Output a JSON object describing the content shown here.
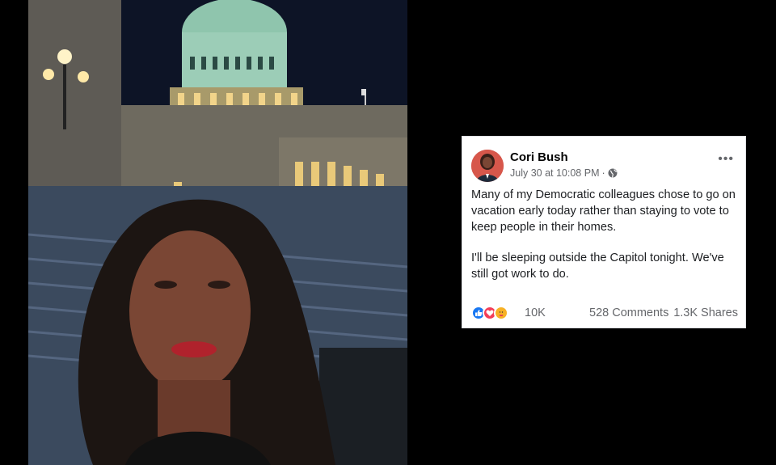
{
  "post": {
    "author": "Cori Bush",
    "timestamp": "July 30 at 10:08 PM",
    "privacy_icon": "globe-icon",
    "more_label": "•••",
    "paragraphs": [
      "Many of my Democratic colleagues chose to go on vacation early today rather than staying to vote to keep people in their homes.",
      "I'll be sleeping outside the Capitol tonight. We've still got work to do."
    ],
    "reactions": [
      "like-icon",
      "love-icon",
      "care-icon"
    ],
    "reaction_count": "10K",
    "comments": "528 Comments",
    "shares": "1.3K Shares"
  },
  "colors": {
    "background": "#000000",
    "card": "#ffffff",
    "link_blue": "#1877f2",
    "muted": "#65676b"
  }
}
